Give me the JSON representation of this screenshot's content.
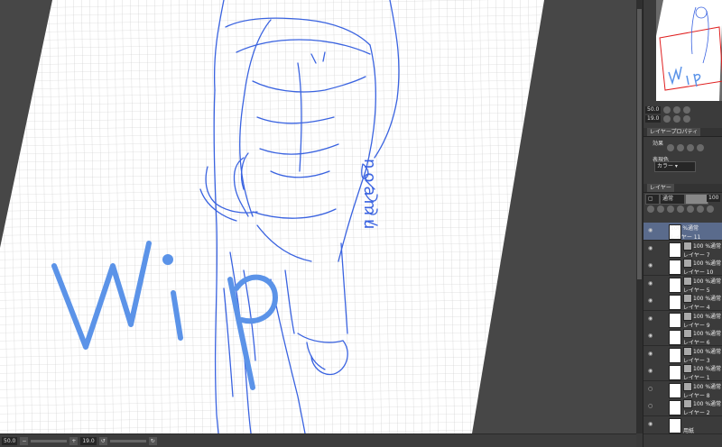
{
  "canvas": {
    "signature": "noamu",
    "wip_text": "WiP"
  },
  "status_bar": {
    "zoom": "50.0",
    "angle": "19.0"
  },
  "navigator": {
    "zoom": "50.0",
    "angle": "19.0"
  },
  "property_panel": {
    "tab": "レイヤープロパティ",
    "effect_label": "効果",
    "color_label": "表現色",
    "color_value": "カラー"
  },
  "layer_panel": {
    "tab": "レイヤー",
    "blend_mode": "通常",
    "opacity": "100",
    "layers": [
      {
        "blend": "100 %通常",
        "name": "レイヤー 11",
        "visible": true
      },
      {
        "blend": "100 %通常",
        "name": "レイヤー 7",
        "visible": true
      },
      {
        "blend": "100 %通常",
        "name": "レイヤー 10",
        "visible": true
      },
      {
        "blend": "100 %通常",
        "name": "レイヤー 5",
        "visible": true
      },
      {
        "blend": "100 %通常",
        "name": "レイヤー 4",
        "visible": true
      },
      {
        "blend": "100 %通常",
        "name": "レイヤー 9",
        "visible": true
      },
      {
        "blend": "100 %通常",
        "name": "レイヤー 6",
        "visible": true
      },
      {
        "blend": "100 %通常",
        "name": "レイヤー 3",
        "visible": true
      },
      {
        "blend": "100 %通常",
        "name": "レイヤー 1",
        "visible": true
      },
      {
        "blend": "100 %通常",
        "name": "レイヤー 8",
        "visible": false
      },
      {
        "blend": "100 %通常",
        "name": "レイヤー 2",
        "visible": false
      },
      {
        "blend": "",
        "name": "用紙",
        "visible": true
      }
    ]
  },
  "colors": {
    "line_blue": "#3a63e0",
    "wip_blue": "#5b93e8",
    "selected_layer": "#5a6b8c"
  }
}
